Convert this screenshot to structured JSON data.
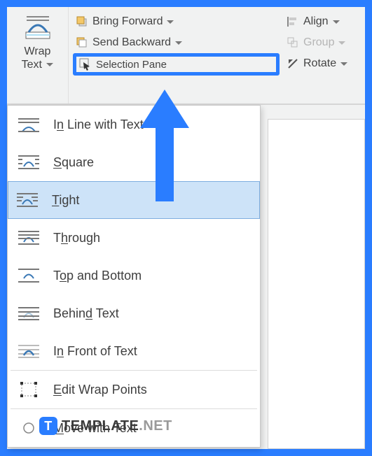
{
  "ribbon": {
    "wrap_text": {
      "label_line1": "Wrap",
      "label_line2": "Text"
    },
    "arrange": {
      "bring_forward": "Bring Forward",
      "send_backward": "Send Backward",
      "selection_pane": "Selection Pane"
    },
    "align_group": {
      "align": "Align",
      "group": "Group",
      "rotate": "Rotate"
    }
  },
  "menu": {
    "in_line": {
      "pre": "I",
      "u": "n",
      "post": " Line with Text"
    },
    "square": {
      "u": "S",
      "post": "quare"
    },
    "tight": {
      "u": "T",
      "post": "ight",
      "selected": true
    },
    "through": {
      "pre": "T",
      "u": "h",
      "post": "rough"
    },
    "top_bottom": {
      "pre": "T",
      "u": "o",
      "post": "p and Bottom"
    },
    "behind": {
      "pre": "Behin",
      "u": "d",
      "post": " Text"
    },
    "in_front": {
      "pre": "I",
      "u": "n",
      "post": " Front of Text"
    },
    "edit_wrap": {
      "u": "E",
      "post": "dit Wrap Points"
    },
    "move_with": {
      "u": "M",
      "post": "ove with Text"
    }
  },
  "watermark": {
    "brand": "TEMPLATE",
    "suffix": ".NET"
  }
}
